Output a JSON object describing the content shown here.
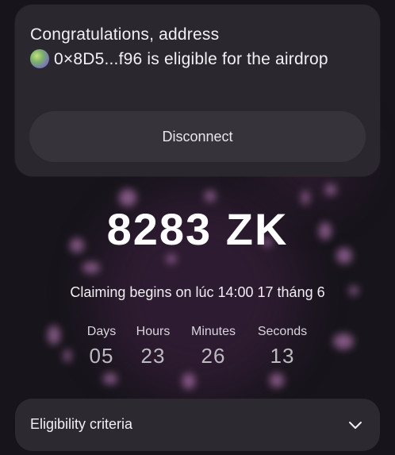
{
  "message": {
    "prefix": "Congratulations, address",
    "address": "0×8D5...f96",
    "suffix": "is eligible for the airdrop"
  },
  "disconnect_label": "Disconnect",
  "amount": "8283 ZK",
  "claim_text": "Claiming begins on lúc 14:00 17 tháng 6",
  "countdown": [
    {
      "label": "Days",
      "value": "05"
    },
    {
      "label": "Hours",
      "value": "23"
    },
    {
      "label": "Minutes",
      "value": "26"
    },
    {
      "label": "Seconds",
      "value": "13"
    }
  ],
  "eligibility_label": "Eligibility criteria",
  "colors": {
    "background": "#17141b",
    "card": "#2a282e",
    "button": "#36343a",
    "firework": "#d98fd6"
  }
}
